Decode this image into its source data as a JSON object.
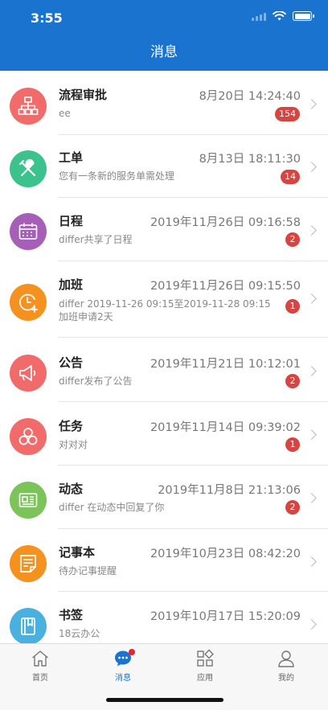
{
  "status_bar": {
    "time": "3:55"
  },
  "header": {
    "title": "消息"
  },
  "messages": [
    {
      "title": "流程审批",
      "time": "8月20日 14:24:40",
      "subtitle": "ee",
      "badge": "154",
      "icon": "flowchart-icon",
      "color": "#f26b6b"
    },
    {
      "title": "工单",
      "time": "8月13日 18:11:30",
      "subtitle": "您有一条新的服务单需处理",
      "badge": "14",
      "icon": "tools-icon",
      "color": "#3cc38d"
    },
    {
      "title": "日程",
      "time": "2019年11月26日 09:16:58",
      "subtitle": "differ共享了日程",
      "badge": "2",
      "icon": "calendar-icon",
      "color": "#a65fb6"
    },
    {
      "title": "加班",
      "time": "2019年11月26日 09:15:50",
      "subtitle": "differ 2019-11-26 09:15至2019-11-28 09:15 加班申请2天",
      "badge": "1",
      "icon": "clock-add-icon",
      "color": "#f5911e"
    },
    {
      "title": "公告",
      "time": "2019年11月21日 10:12:01",
      "subtitle": "differ发布了公告",
      "badge": "2",
      "icon": "megaphone-icon",
      "color": "#f26b6b"
    },
    {
      "title": "任务",
      "time": "2019年11月14日 09:39:02",
      "subtitle": "对对对",
      "badge": "1",
      "icon": "task-nodes-icon",
      "color": "#f26b6b"
    },
    {
      "title": "动态",
      "time": "2019年11月8日 21:13:06",
      "subtitle": "differ 在动态中回复了你",
      "badge": "2",
      "icon": "news-icon",
      "color": "#7cc35a"
    },
    {
      "title": "记事本",
      "time": "2019年10月23日 08:42:20",
      "subtitle": "待办记事提醒",
      "badge": "",
      "icon": "notepad-icon",
      "color": "#f5911e"
    },
    {
      "title": "书签",
      "time": "2019年10月17日 15:20:09",
      "subtitle": "18云办公",
      "badge": "",
      "icon": "bookmark-icon",
      "color": "#4ab0e0"
    }
  ],
  "tab_bar": {
    "tabs": [
      {
        "label": "首页",
        "icon": "home-icon",
        "active": false
      },
      {
        "label": "消息",
        "icon": "chat-icon",
        "active": true
      },
      {
        "label": "应用",
        "icon": "apps-grid-icon",
        "active": false
      },
      {
        "label": "我的",
        "icon": "person-icon",
        "active": false
      }
    ]
  },
  "colors": {
    "primary": "#1a74cf",
    "badge": "#d64541",
    "tab_dot": "#e8252c"
  }
}
